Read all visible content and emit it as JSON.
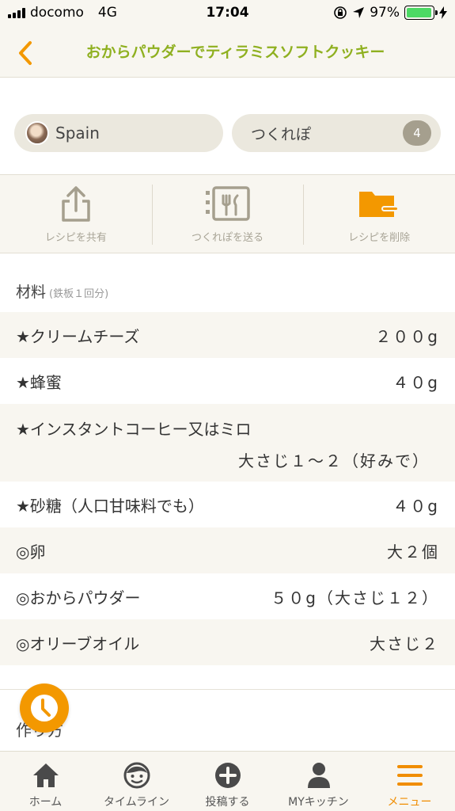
{
  "status_bar": {
    "carrier": "docomo",
    "network": "4G",
    "time": "17:04",
    "battery": "97%",
    "battery_level": 0.97
  },
  "nav": {
    "title": "おからパウダーでティラミスソフトクッキー",
    "back_icon": "chevron-left-icon"
  },
  "author": {
    "name": "Spain"
  },
  "reports": {
    "label": "つくれぽ",
    "count": "4"
  },
  "actions": [
    {
      "label": "レシピを共有",
      "icon": "share-icon"
    },
    {
      "label": "つくれぽを送る",
      "icon": "send-report-icon"
    },
    {
      "label": "レシピを削除",
      "icon": "folder-icon"
    }
  ],
  "ingredients": {
    "title": "材料",
    "servings": "(鉄板１回分)",
    "items": [
      {
        "name": "★クリームチーズ",
        "qty": "２００g"
      },
      {
        "name": "★蜂蜜",
        "qty": "４０g"
      },
      {
        "name": "★インスタントコーヒー又はミロ",
        "qty": "大さじ１〜２（好みで）"
      },
      {
        "name": "★砂糖（人口甘味料でも）",
        "qty": "４０g"
      },
      {
        "name": "◎卵",
        "qty": "大２個"
      },
      {
        "name": "◎おからパウダー",
        "qty": "５０g（大さじ１２）"
      },
      {
        "name": "◎オリーブオイル",
        "qty": "大さじ２"
      }
    ]
  },
  "steps": {
    "title": "作り方"
  },
  "tabs": [
    {
      "label": "ホーム",
      "icon": "home-icon"
    },
    {
      "label": "タイムライン",
      "icon": "face-icon"
    },
    {
      "label": "投稿する",
      "icon": "plus-circle-icon"
    },
    {
      "label": "MYキッチン",
      "icon": "person-icon"
    },
    {
      "label": "メニュー",
      "icon": "menu-icon"
    }
  ],
  "colors": {
    "accent_green": "#8fb020",
    "accent_orange": "#f39800",
    "background_beige": "#f8f6f0"
  }
}
